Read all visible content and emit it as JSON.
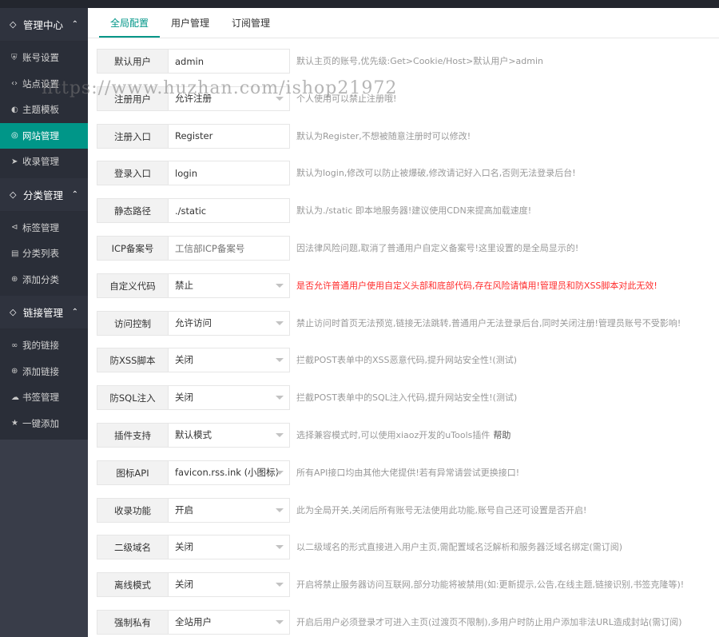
{
  "sidebar": {
    "groups": [
      {
        "title": "管理中心",
        "icon": "tag-icon",
        "items": [
          {
            "label": "账号设置",
            "icon": "shield-icon"
          },
          {
            "label": "站点设置",
            "icon": "code-icon"
          },
          {
            "label": "主题模板",
            "icon": "palette-icon"
          },
          {
            "label": "网站管理",
            "icon": "globe-icon",
            "active": true
          },
          {
            "label": "收录管理",
            "icon": "send-icon"
          }
        ]
      },
      {
        "title": "分类管理",
        "icon": "tag-icon",
        "items": [
          {
            "label": "标签管理",
            "icon": "share-icon"
          },
          {
            "label": "分类列表",
            "icon": "file-icon"
          },
          {
            "label": "添加分类",
            "icon": "add-circle-icon"
          }
        ]
      },
      {
        "title": "链接管理",
        "icon": "tag-icon",
        "items": [
          {
            "label": "我的链接",
            "icon": "link-icon"
          },
          {
            "label": "添加链接",
            "icon": "add-circle-icon"
          },
          {
            "label": "书签管理",
            "icon": "cloud-icon"
          },
          {
            "label": "一键添加",
            "icon": "star-icon"
          }
        ]
      }
    ]
  },
  "tabs": [
    {
      "label": "全局配置",
      "active": true
    },
    {
      "label": "用户管理"
    },
    {
      "label": "订阅管理"
    }
  ],
  "form": {
    "rows": [
      {
        "label": "默认用户",
        "type": "input",
        "value": "admin",
        "hint": "默认主页的账号,优先级:Get>Cookie/Host>默认用户>admin"
      },
      {
        "label": "注册用户",
        "type": "select",
        "value": "允许注册",
        "hint": "个人使用可以禁止注册哦!"
      },
      {
        "label": "注册入口",
        "type": "input",
        "value": "Register",
        "hint": "默认为Register,不想被随意注册时可以修改!"
      },
      {
        "label": "登录入口",
        "type": "input",
        "value": "login",
        "hint": "默认为login,修改可以防止被爆破,修改请记好入口名,否则无法登录后台!"
      },
      {
        "label": "静态路径",
        "type": "input",
        "value": "./static",
        "hint": "默认为./static 即本地服务器!建议使用CDN来提高加载速度!"
      },
      {
        "label": "ICP备案号",
        "type": "input",
        "value": "",
        "placeholder": "工信部ICP备案号",
        "hint": "因法律风险问题,取消了普通用户自定义备案号!这里设置的是全局显示的!"
      },
      {
        "label": "自定义代码",
        "type": "select",
        "value": "禁止",
        "hint": "是否允许普通用户使用自定义头部和底部代码,存在风险请慎用!管理员和防XSS脚本对此无效!",
        "hint_color": "#ff2d2d"
      },
      {
        "label": "访问控制",
        "type": "select",
        "value": "允许访问",
        "hint": "禁止访问时首页无法预览,链接无法跳转,普通用户无法登录后台,同时关闭注册!管理员账号不受影响!"
      },
      {
        "label": "防XSS脚本",
        "type": "select",
        "value": "关闭",
        "hint": "拦截POST表单中的XSS恶意代码,提升网站安全性!(测试)"
      },
      {
        "label": "防SQL注入",
        "type": "select",
        "value": "关闭",
        "hint": "拦截POST表单中的SQL注入代码,提升网站安全性!(测试)"
      },
      {
        "label": "插件支持",
        "type": "select",
        "value": "默认模式",
        "hint": "选择兼容模式时,可以使用xiaoz开发的uTools插件",
        "link": "帮助"
      },
      {
        "label": "图标API",
        "type": "select",
        "value": "favicon.rss.ink (小图标)",
        "hint": "所有API接口均由其他大佬提供!若有异常请尝试更换接口!"
      },
      {
        "label": "收录功能",
        "type": "select",
        "value": "开启",
        "hint": "此为全局开关,关闭后所有账号无法使用此功能,账号自己还可设置是否开启!"
      },
      {
        "label": "二级域名",
        "type": "select",
        "value": "关闭",
        "hint": "以二级域名的形式直接进入用户主页,需配置域名泛解析和服务器泛域名绑定(需订阅)"
      },
      {
        "label": "离线模式",
        "type": "select",
        "value": "关闭",
        "hint": "开启将禁止服务器访问互联网,部分功能将被禁用(如:更新提示,公告,在线主题,链接识别,书签克隆等)!"
      },
      {
        "label": "强制私有",
        "type": "select",
        "value": "全站用户",
        "hint": "开启后用户必须登录才可进入主页(过渡页不限制),多用户时防止用户添加非法URL造成封站(需订阅)"
      }
    ]
  },
  "watermark": "https://www.huzhan.com/ishop21972",
  "colors": {
    "accent": "#009688",
    "sidebar_bg": "#393d49",
    "warning": "#ff2d2d"
  }
}
